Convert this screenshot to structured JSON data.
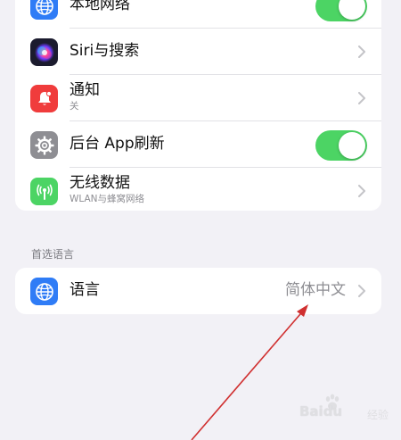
{
  "rows": [
    {
      "label": "本地网络",
      "control": "toggle",
      "on": true,
      "icon": "globe-icon",
      "color": "#2f7cf6"
    },
    {
      "label": "Siri与搜索",
      "control": "chevron",
      "icon": "siri-icon"
    },
    {
      "label": "通知",
      "sublabel": "关",
      "control": "chevron",
      "icon": "bell-icon",
      "color": "#f03c3c"
    },
    {
      "label": "后台 App刷新",
      "control": "toggle",
      "on": true,
      "icon": "gear-icon",
      "color": "#8e8e93"
    },
    {
      "label": "无线数据",
      "sublabel": "WLAN与蜂窝网络",
      "control": "chevron",
      "icon": "antenna-icon",
      "color": "#4cd464"
    }
  ],
  "language_section": {
    "header": "首选语言",
    "row": {
      "label": "语言",
      "value": "简体中文",
      "icon": "globe-icon",
      "color": "#2f7cf6"
    }
  },
  "annotation": {
    "color": "#d03030"
  },
  "watermark": {
    "brand": "Baidu",
    "text": "经验"
  },
  "colors": {
    "toggle_on": "#4cd464",
    "background": "#f2f1f6"
  }
}
